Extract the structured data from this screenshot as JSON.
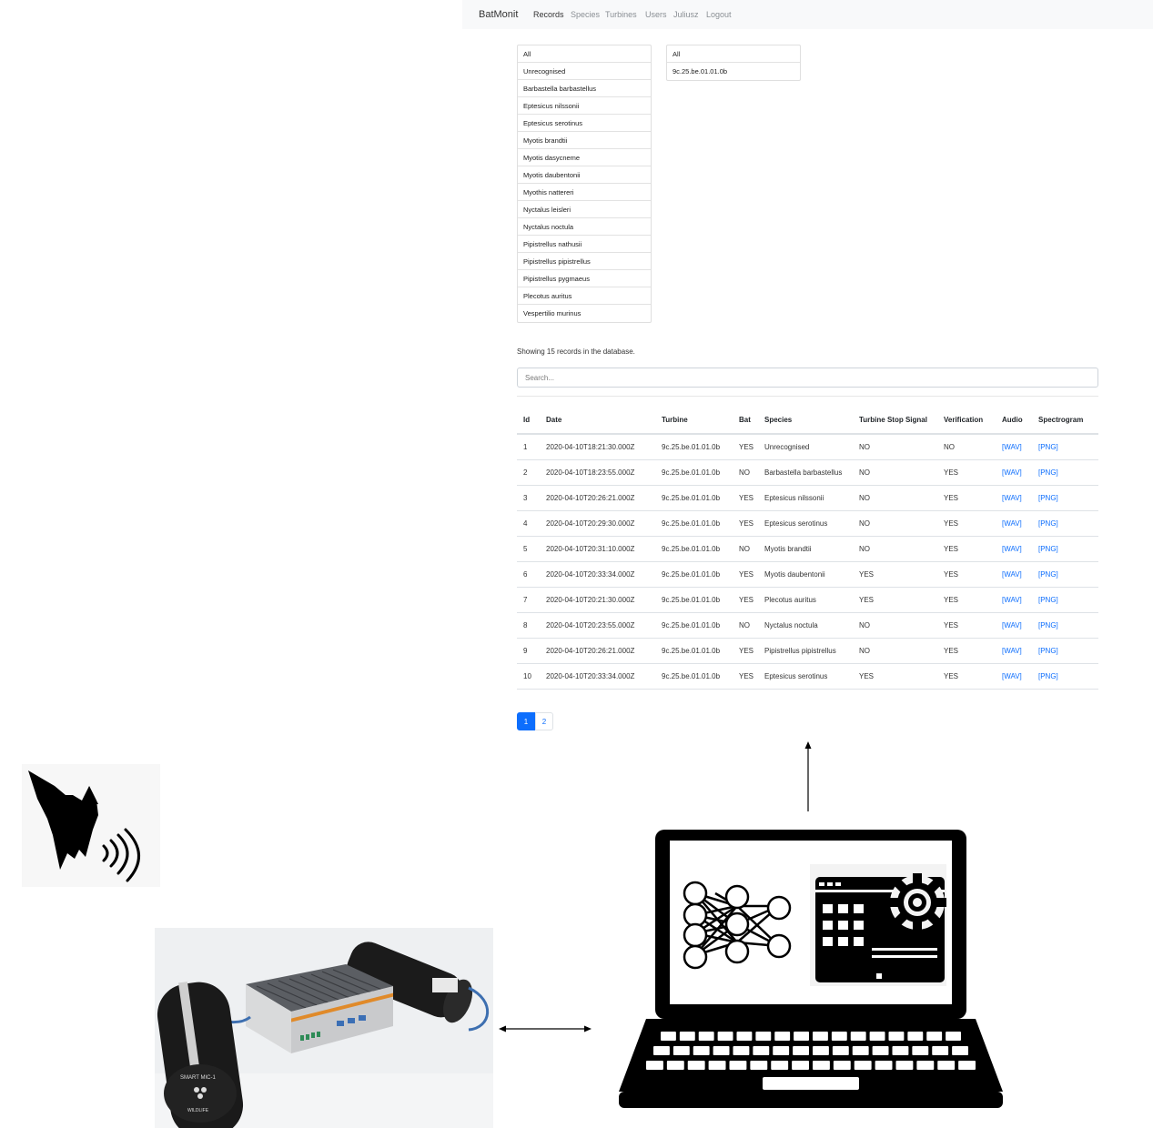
{
  "navbar": {
    "brand": "BatMonit",
    "links": [
      "Records",
      "Species",
      "Turbines",
      "Users",
      "Juliusz",
      "Logout"
    ]
  },
  "species_filter": [
    "All",
    "Unrecognised",
    "Barbastella barbastellus",
    "Eptesicus nilssonii",
    "Eptesicus serotinus",
    "Myotis brandtii",
    "Myotis dasycneme",
    "Myotis daubentonii",
    "Myothis nattereri",
    "Nyctalus leisleri",
    "Nyctalus noctula",
    "Pipistrellus nathusii",
    "Pipistrellus pipistrellus",
    "Pipistrellus pygmaeus",
    "Plecotus auritus",
    "Vespertilio murinus"
  ],
  "turbine_filter": [
    "All",
    "9c.25.be.01.01.0b"
  ],
  "summary": "Showing 15 records in the database.",
  "search": {
    "placeholder": "Search..."
  },
  "table": {
    "headers": [
      "Id",
      "Date",
      "Turbine",
      "Bat",
      "Species",
      "Turbine Stop Signal",
      "Verification",
      "Audio",
      "Spectrogram"
    ],
    "rows": [
      [
        "1",
        "2020-04-10T18:21:30.000Z",
        "9c.25.be.01.01.0b",
        "YES",
        "Unrecognised",
        "NO",
        "NO",
        "[WAV]",
        "[PNG]"
      ],
      [
        "2",
        "2020-04-10T18:23:55.000Z",
        "9c.25.be.01.01.0b",
        "NO",
        "Barbastella barbastellus",
        "NO",
        "YES",
        "[WAV]",
        "[PNG]"
      ],
      [
        "3",
        "2020-04-10T20:26:21.000Z",
        "9c.25.be.01.01.0b",
        "YES",
        "Eptesicus nilssonii",
        "NO",
        "YES",
        "[WAV]",
        "[PNG]"
      ],
      [
        "4",
        "2020-04-10T20:29:30.000Z",
        "9c.25.be.01.01.0b",
        "YES",
        "Eptesicus serotinus",
        "NO",
        "YES",
        "[WAV]",
        "[PNG]"
      ],
      [
        "5",
        "2020-04-10T20:31:10.000Z",
        "9c.25.be.01.01.0b",
        "NO",
        "Myotis brandtii",
        "NO",
        "YES",
        "[WAV]",
        "[PNG]"
      ],
      [
        "6",
        "2020-04-10T20:33:34.000Z",
        "9c.25.be.01.01.0b",
        "YES",
        "Myotis daubentonii",
        "YES",
        "YES",
        "[WAV]",
        "[PNG]"
      ],
      [
        "7",
        "2020-04-10T20:21:30.000Z",
        "9c.25.be.01.01.0b",
        "YES",
        "Plecotus auritus",
        "YES",
        "YES",
        "[WAV]",
        "[PNG]"
      ],
      [
        "8",
        "2020-04-10T20:23:55.000Z",
        "9c.25.be.01.01.0b",
        "NO",
        "Nyctalus noctula",
        "NO",
        "YES",
        "[WAV]",
        "[PNG]"
      ],
      [
        "9",
        "2020-04-10T20:26:21.000Z",
        "9c.25.be.01.01.0b",
        "YES",
        "Pipistrellus pipistrellus",
        "NO",
        "YES",
        "[WAV]",
        "[PNG]"
      ],
      [
        "10",
        "2020-04-10T20:33:34.000Z",
        "9c.25.be.01.01.0b",
        "YES",
        "Eptesicus serotinus",
        "YES",
        "YES",
        "[WAV]",
        "[PNG]"
      ]
    ]
  },
  "pagination": [
    "1",
    "2"
  ],
  "device": {
    "mic_label": "SMART MIC-1",
    "brand": "WILDLIFE"
  },
  "colors": {
    "accent": "#0d6efd",
    "navbar_bg": "#f8f9fa"
  }
}
